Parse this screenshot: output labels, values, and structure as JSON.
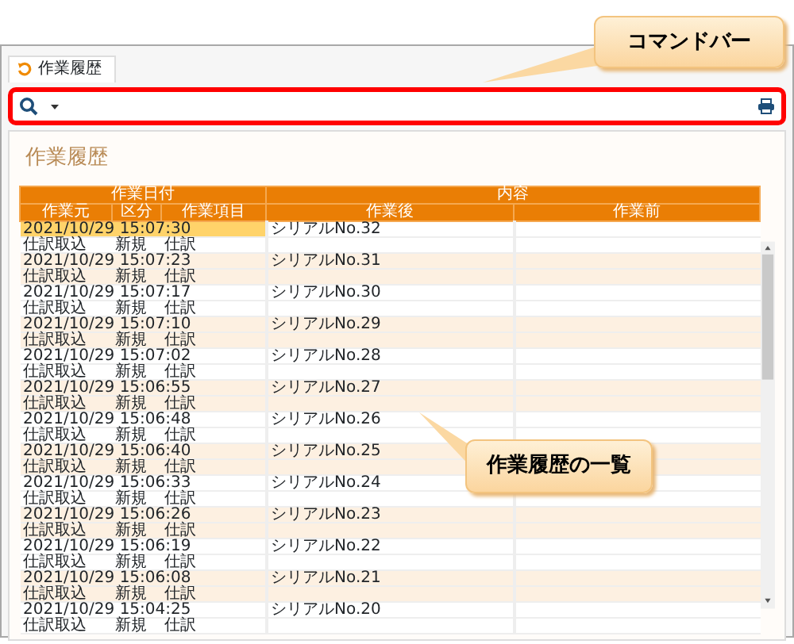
{
  "tab": {
    "label": "作業履歴",
    "selected": true
  },
  "panel_title": "作業履歴",
  "table": {
    "group_headers": [
      "作業日付",
      "内容"
    ],
    "columns": [
      "作業元",
      "区分",
      "作業項目",
      "作業後",
      "作業前"
    ],
    "rows": [
      {
        "datetime": "2021/10/29 15:07:30",
        "serial": "シリアルNo.32",
        "source": "仕訳取込",
        "category": "新規",
        "item": "仕訳",
        "selected": true
      },
      {
        "datetime": "2021/10/29 15:07:23",
        "serial": "シリアルNo.31",
        "source": "仕訳取込",
        "category": "新規",
        "item": "仕訳",
        "selected": false
      },
      {
        "datetime": "2021/10/29 15:07:17",
        "serial": "シリアルNo.30",
        "source": "仕訳取込",
        "category": "新規",
        "item": "仕訳",
        "selected": false
      },
      {
        "datetime": "2021/10/29 15:07:10",
        "serial": "シリアルNo.29",
        "source": "仕訳取込",
        "category": "新規",
        "item": "仕訳",
        "selected": false
      },
      {
        "datetime": "2021/10/29 15:07:02",
        "serial": "シリアルNo.28",
        "source": "仕訳取込",
        "category": "新規",
        "item": "仕訳",
        "selected": false
      },
      {
        "datetime": "2021/10/29 15:06:55",
        "serial": "シリアルNo.27",
        "source": "仕訳取込",
        "category": "新規",
        "item": "仕訳",
        "selected": false
      },
      {
        "datetime": "2021/10/29 15:06:48",
        "serial": "シリアルNo.26",
        "source": "仕訳取込",
        "category": "新規",
        "item": "仕訳",
        "selected": false
      },
      {
        "datetime": "2021/10/29 15:06:40",
        "serial": "シリアルNo.25",
        "source": "仕訳取込",
        "category": "新規",
        "item": "仕訳",
        "selected": false
      },
      {
        "datetime": "2021/10/29 15:06:33",
        "serial": "シリアルNo.24",
        "source": "仕訳取込",
        "category": "新規",
        "item": "仕訳",
        "selected": false
      },
      {
        "datetime": "2021/10/29 15:06:26",
        "serial": "シリアルNo.23",
        "source": "仕訳取込",
        "category": "新規",
        "item": "仕訳",
        "selected": false
      },
      {
        "datetime": "2021/10/29 15:06:19",
        "serial": "シリアルNo.22",
        "source": "仕訳取込",
        "category": "新規",
        "item": "仕訳",
        "selected": false
      },
      {
        "datetime": "2021/10/29 15:06:08",
        "serial": "シリアルNo.21",
        "source": "仕訳取込",
        "category": "新規",
        "item": "仕訳",
        "selected": false
      },
      {
        "datetime": "2021/10/29 15:04:25",
        "serial": "シリアルNo.20",
        "source": "仕訳取込",
        "category": "新規",
        "item": "仕訳",
        "selected": false
      }
    ]
  },
  "callouts": [
    {
      "text": "コマンドバー"
    },
    {
      "text": "作業履歴の一覧"
    }
  ]
}
